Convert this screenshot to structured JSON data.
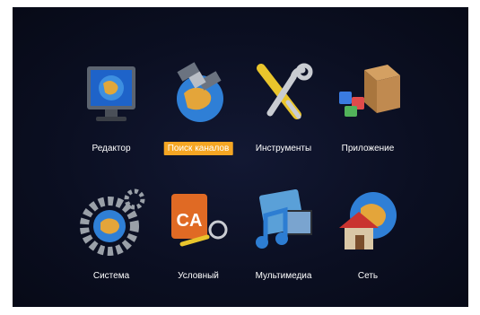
{
  "menu": {
    "items": [
      {
        "label": "Редактор",
        "icon": "monitor-globe-icon"
      },
      {
        "label": "Поиск каналов",
        "icon": "satellite-globe-icon",
        "selected": true
      },
      {
        "label": "Инструменты",
        "icon": "tools-icon"
      },
      {
        "label": "Приложение",
        "icon": "apps-box-icon"
      },
      {
        "label": "Система",
        "icon": "gears-globe-icon"
      },
      {
        "label": "Условный",
        "icon": "ca-card-key-icon"
      },
      {
        "label": "Мультимедиа",
        "icon": "media-note-film-icon"
      },
      {
        "label": "Сеть",
        "icon": "house-globe-icon"
      }
    ]
  },
  "colors": {
    "background": "#0b0f22",
    "selected": "#f5a623",
    "text": "#ffffff"
  }
}
